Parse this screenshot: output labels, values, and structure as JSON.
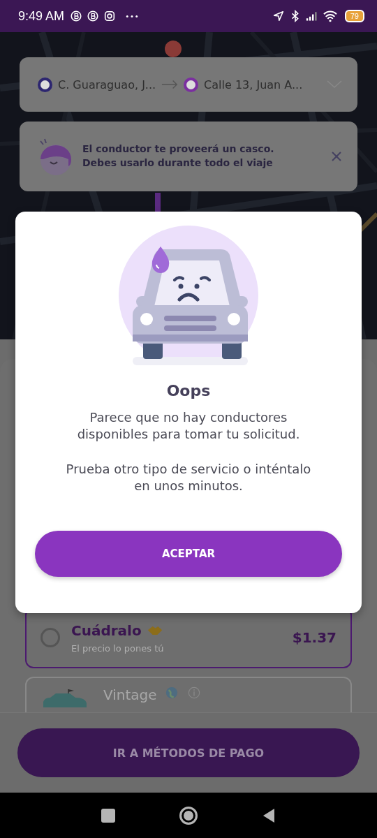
{
  "status_bar": {
    "time": "9:49 AM",
    "battery": "79"
  },
  "route": {
    "origin": "C. Guaraguao, J...",
    "destination": "Calle 13, Juan A..."
  },
  "notice": {
    "text": "El conductor te proveerá un casco.\nDebes usarlo durante todo el viaje"
  },
  "services": [
    {
      "kind": "radio",
      "name": "Cuádralo",
      "subtitle": "El precio lo pones tú",
      "price": "$1.37",
      "highlighted": true,
      "selected": false
    },
    {
      "kind": "car",
      "name": "Vintage",
      "highlighted": false
    }
  ],
  "dialog": {
    "title": "Oops",
    "messages": [
      "Parece que no hay conductores disponibles para tomar tu solicitud.",
      "Prueba otro tipo de servicio o inténtalo en unos minutos."
    ],
    "button": "ACEPTAR"
  },
  "footer": {
    "button": "IR A MÉTODOS DE PAGO"
  }
}
